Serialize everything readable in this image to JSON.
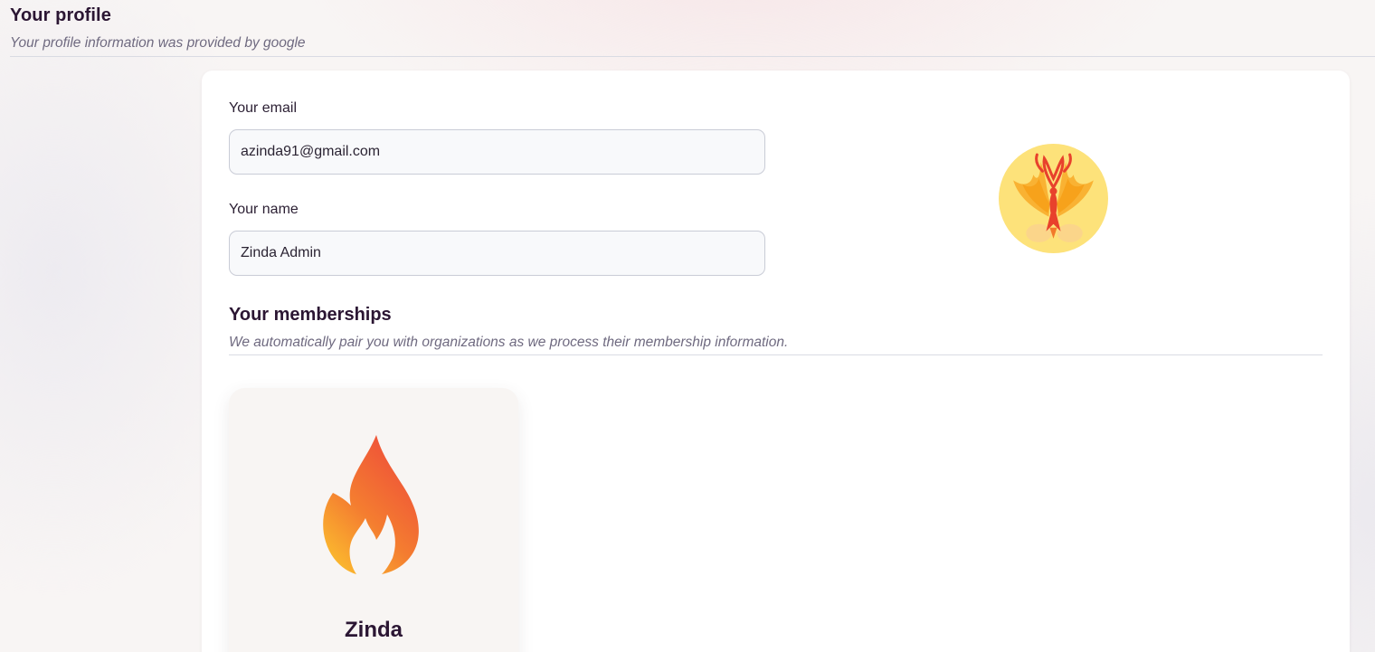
{
  "header": {
    "title": "Your profile",
    "subtitle": "Your profile information was provided by google"
  },
  "profile": {
    "email_label": "Your email",
    "email_value": "azinda91@gmail.com",
    "name_label": "Your name",
    "name_value": "Zinda Admin",
    "avatar_icon": "phoenix-avatar-icon"
  },
  "memberships": {
    "title": "Your memberships",
    "subtitle": "We automatically pair you with organizations as we process their membership information.",
    "items": [
      {
        "name": "Zinda",
        "logo_icon": "flame-icon"
      }
    ]
  },
  "colors": {
    "heading": "#2b1633",
    "muted": "#6f6a80",
    "card_bg": "#ffffff",
    "org_card_bg": "#f8f5f3",
    "avatar_bg": "#fde27a",
    "flame_red": "#ee4b3a",
    "flame_yellow": "#fcc12e"
  }
}
